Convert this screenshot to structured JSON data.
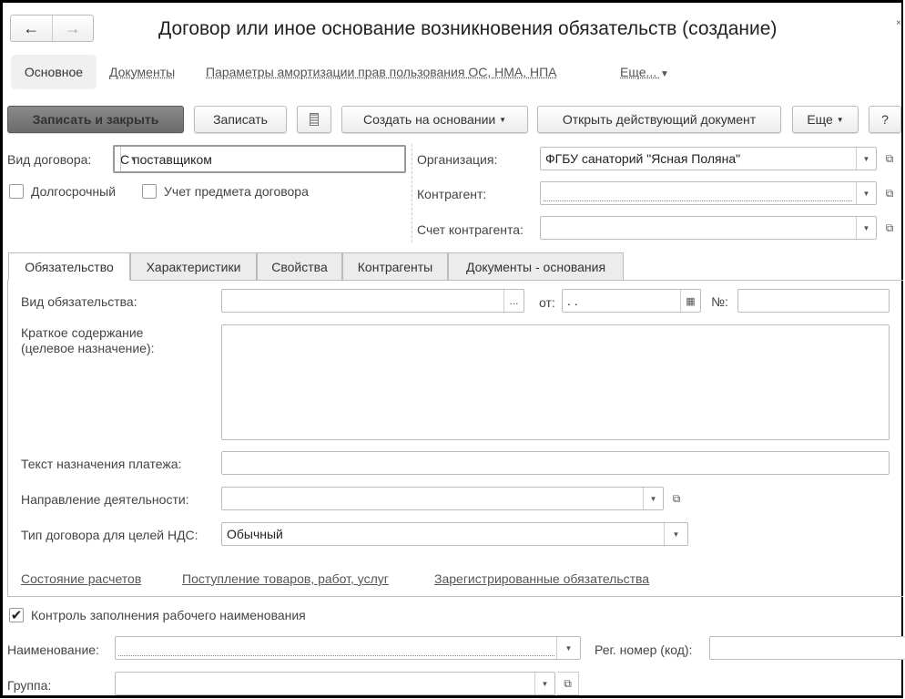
{
  "window": {
    "title": "Договор или иное основание возникновения обязательств (создание)",
    "close": "×"
  },
  "nav": {
    "back": "←",
    "forward": "→"
  },
  "sections": [
    {
      "label": "Основное"
    },
    {
      "label": "Документы"
    },
    {
      "label": "Параметры амортизации прав пользования ОС, НМА, НПА"
    },
    {
      "label": "Еще..."
    }
  ],
  "toolbar": {
    "save_close": "Записать и закрыть",
    "save": "Записать",
    "create_based": "Создать на основании",
    "open_doc": "Открыть действующий документ",
    "more": "Еще",
    "help": "?"
  },
  "header": {
    "contract_type_label": "Вид договора:",
    "contract_type_value": "С поставщиком",
    "long_term_label": "Долгосрочный",
    "subject_label": "Учет предмета договора",
    "org_label": "Организация:",
    "org_value": "ФГБУ санаторий \"Ясная Поляна\"",
    "counterparty_label": "Контрагент:",
    "counterparty_value": "",
    "account_label": "Счет контрагента:",
    "account_value": ""
  },
  "tabs": [
    {
      "label": "Обязательство"
    },
    {
      "label": "Характеристики"
    },
    {
      "label": "Свойства"
    },
    {
      "label": "Контрагенты"
    },
    {
      "label": "Документы - основания"
    }
  ],
  "obligation": {
    "kind_label": "Вид обязательства:",
    "kind_value": "",
    "from_label": "от:",
    "date_value": " .  .",
    "num_label": "№:",
    "num_value": "",
    "summary_label_1": "Краткое содержание",
    "summary_label_2": "(целевое назначение):",
    "summary_value": "",
    "payment_text_label": "Текст назначения платежа:",
    "payment_text_value": "",
    "activity_label": "Направление деятельности:",
    "activity_value": "",
    "vat_type_label": "Тип договора для целей НДС:",
    "vat_type_value": "Обычный",
    "links": [
      "Состояние расчетов",
      "Поступление товаров, работ, услуг",
      "Зарегистрированные обязательства"
    ]
  },
  "footer": {
    "control_label": "Контроль заполнения рабочего наименования",
    "control_checked": true,
    "name_label": "Наименование:",
    "name_value": "",
    "reg_label": "Рег. номер (код):",
    "reg_value": "",
    "group_label": "Группа:",
    "group_value": ""
  }
}
